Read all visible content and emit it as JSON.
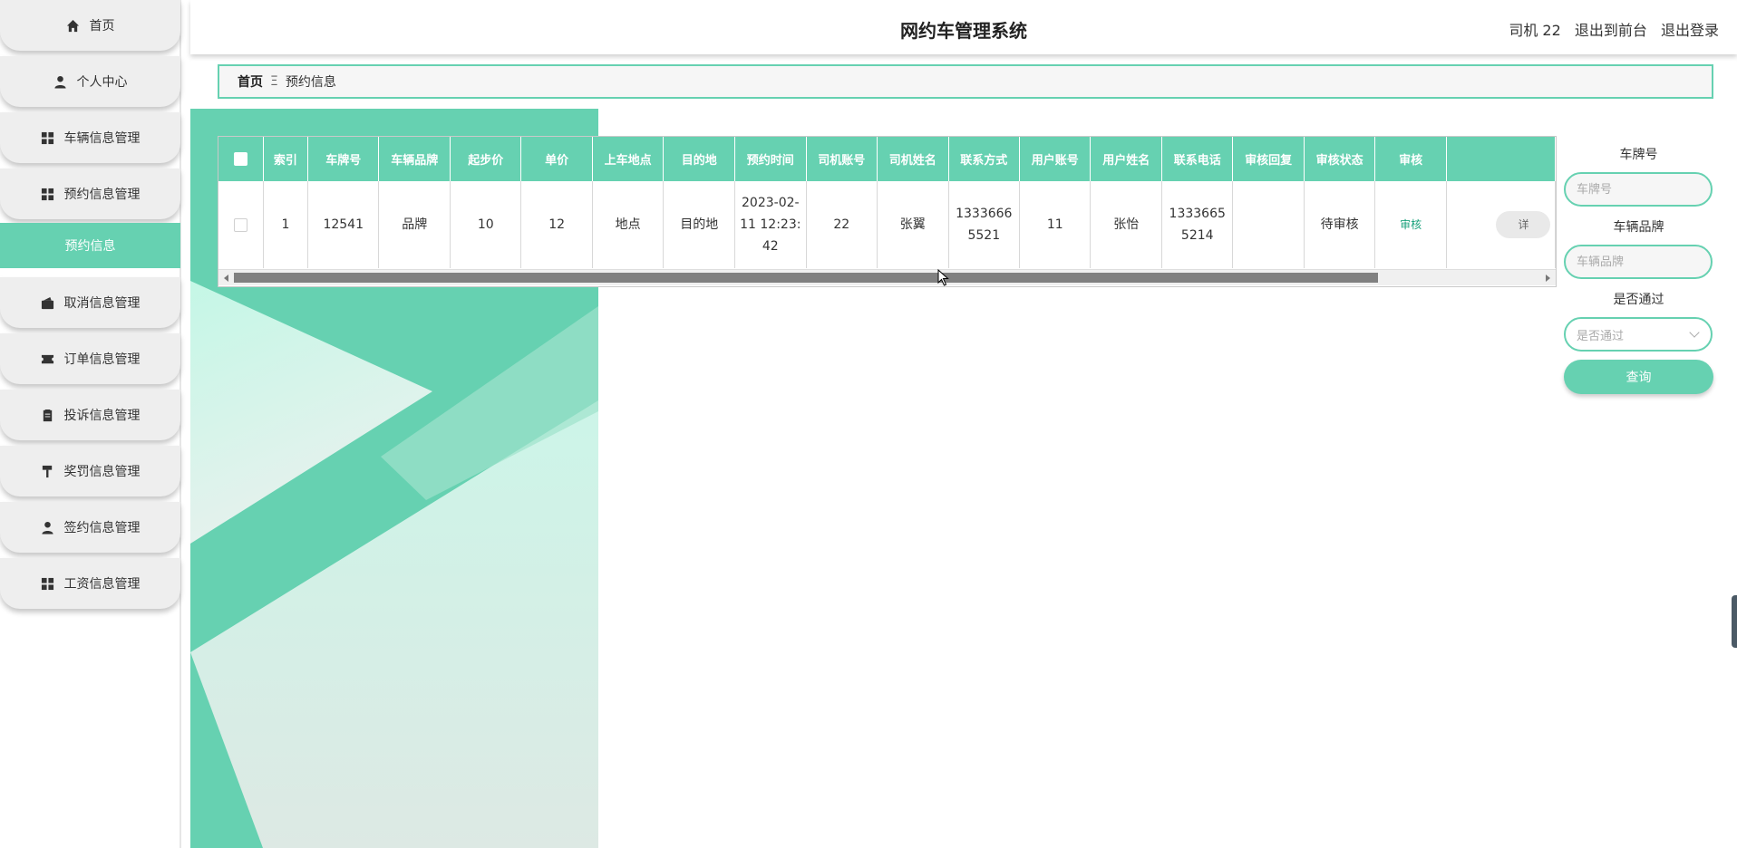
{
  "app": {
    "title": "网约车管理系统"
  },
  "header": {
    "user": "司机 22",
    "to_front": "退出到前台",
    "logout": "退出登录"
  },
  "sidebar": {
    "items": [
      {
        "label": "首页",
        "icon": "home-icon"
      },
      {
        "label": "个人中心",
        "icon": "person-icon"
      },
      {
        "label": "车辆信息管理",
        "icon": "grid-icon"
      },
      {
        "label": "预约信息管理",
        "icon": "grid-icon"
      },
      {
        "label": "取消信息管理",
        "icon": "wallet-icon"
      },
      {
        "label": "订单信息管理",
        "icon": "ticket-icon"
      },
      {
        "label": "投诉信息管理",
        "icon": "clipboard-icon"
      },
      {
        "label": "奖罚信息管理",
        "icon": "paint-roller-icon"
      },
      {
        "label": "签约信息管理",
        "icon": "person-icon"
      },
      {
        "label": "工资信息管理",
        "icon": "grid-icon"
      }
    ],
    "active_sub": "预约信息"
  },
  "breadcrumb": {
    "home": "首页",
    "separator": "Ξ",
    "current": "预约信息"
  },
  "table": {
    "columns": [
      "索引",
      "车牌号",
      "车辆品牌",
      "起步价",
      "单价",
      "上车地点",
      "目的地",
      "预约时间",
      "司机账号",
      "司机姓名",
      "联系方式",
      "用户账号",
      "用户姓名",
      "联系电话",
      "审核回复",
      "审核状态",
      "审核"
    ],
    "rows": [
      {
        "index": "1",
        "plate": "12541",
        "brand": "品牌",
        "start_price": "10",
        "unit_price": "12",
        "pickup": "地点",
        "destination": "目的地",
        "time": "2023-02-11 12:23:42",
        "driver_account": "22",
        "driver_name": "张翼",
        "contact": "13336665521",
        "user_account": "11",
        "user_name": "张怡",
        "phone": "13336655214",
        "review_reply": "",
        "review_status": "待审核",
        "review_action": "审核",
        "detail": "详"
      }
    ]
  },
  "search": {
    "plate_label": "车牌号",
    "plate_placeholder": "车牌号",
    "brand_label": "车辆品牌",
    "brand_placeholder": "车辆品牌",
    "pass_label": "是否通过",
    "pass_placeholder": "是否通过",
    "query": "查询"
  },
  "colors": {
    "accent": "#66d1b1",
    "link": "#1aa27c"
  }
}
